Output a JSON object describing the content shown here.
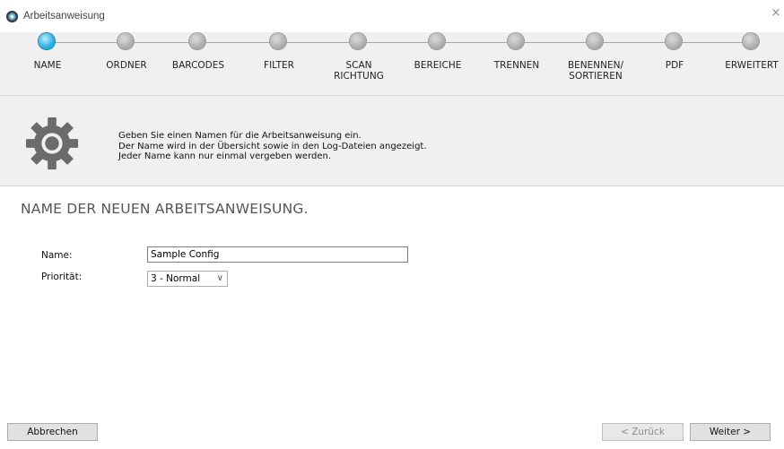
{
  "window": {
    "title": "Arbeitsanweisung",
    "close_glyph": "×",
    "app_icon": "gear-globe-icon"
  },
  "steps": [
    {
      "label": "NAME",
      "active": true
    },
    {
      "label": "ORDNER",
      "active": false
    },
    {
      "label": "BARCODES",
      "active": false
    },
    {
      "label": "FILTER",
      "active": false
    },
    {
      "label": "SCAN\nRICHTUNG",
      "active": false
    },
    {
      "label": "BEREICHE",
      "active": false
    },
    {
      "label": "TRENNEN",
      "active": false
    },
    {
      "label": "BENENNEN/\nSORTIEREN",
      "active": false
    },
    {
      "label": "PDF",
      "active": false
    },
    {
      "label": "ERWEITERT",
      "active": false
    }
  ],
  "info": {
    "icon": "gear-icon",
    "text": "Geben Sie einen Namen für die Arbeitsanweisung ein.\nDer Name wird in der Übersicht sowie in den Log-Dateien angezeigt.\nJeder Name kann nur einmal vergeben werden."
  },
  "form": {
    "heading": "NAME DER NEUEN ARBEITSANWEISUNG.",
    "name_label": "Name:",
    "name_value": "Sample Config",
    "priority_label": "Priorität:",
    "priority_value": "3 - Normal"
  },
  "buttons": {
    "cancel": "Abbrechen",
    "back": "< Zurück",
    "next": "Weiter >"
  },
  "colors": {
    "active_step": "#33b4e8",
    "inactive_step": "#b3b3b3",
    "panel_bg": "#f0f0f0"
  }
}
